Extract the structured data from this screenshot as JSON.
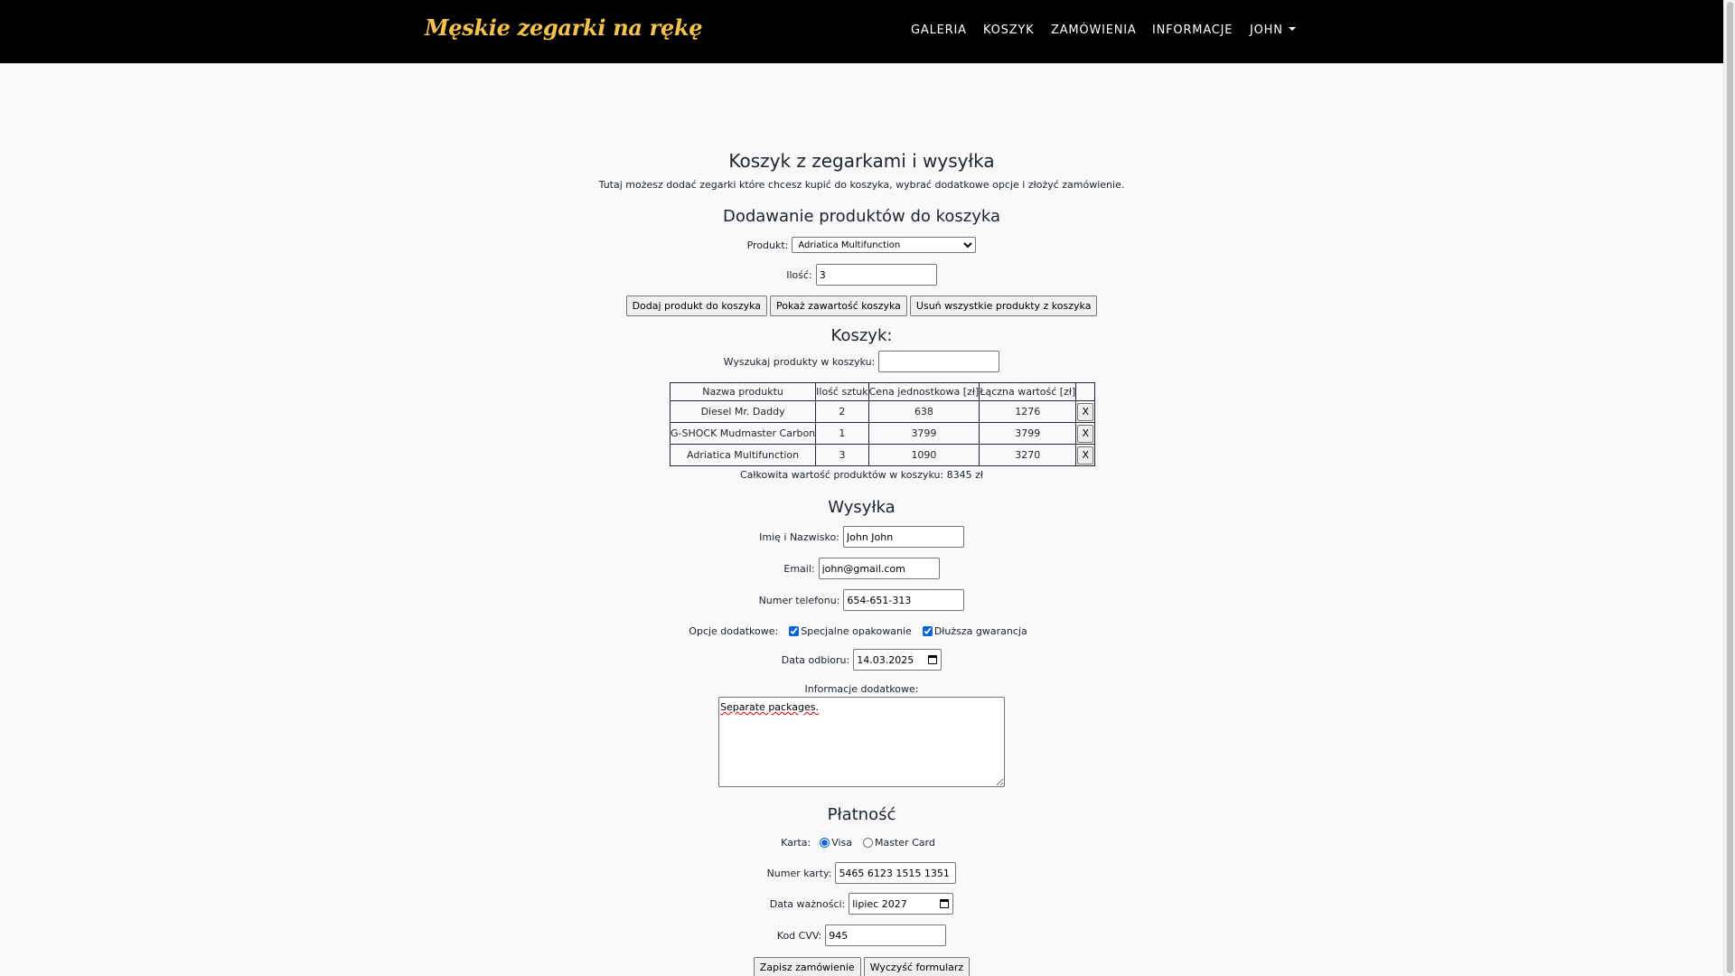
{
  "navbar": {
    "brand": "Męskie zegarki na rękę",
    "links": [
      "GALERIA",
      "KOSZYK",
      "ZAMÓWIENIA",
      "INFORMACJE"
    ],
    "user": "JOHN"
  },
  "header": {
    "title": "Koszyk z zegarkami i wysyłka",
    "description": "Tutaj możesz dodać zegarki które chcesz kupić do koszyka, wybrać dodatkowe opcje i złożyć zamówienie."
  },
  "add_section": {
    "heading": "Dodawanie produktów do koszyka",
    "product_label": "Produkt:",
    "product_selected": "Adriatica Multifunction",
    "qty_label": "Ilość:",
    "qty_value": "3",
    "btn_add": "Dodaj produkt do koszyka",
    "btn_show": "Pokaż zawartość koszyka",
    "btn_clear": "Usuń wszystkie produkty z koszyka"
  },
  "cart": {
    "heading": "Koszyk:",
    "search_label": "Wyszukaj produkty w koszyku:",
    "search_value": "",
    "columns": [
      "Nazwa produktu",
      "Ilość sztuk",
      "Cena jednostkowa [zł]",
      "Łączna wartość [zł]",
      ""
    ],
    "rows": [
      {
        "name": "Diesel Mr. Daddy",
        "qty": "2",
        "price": "638",
        "total": "1276",
        "remove": "X"
      },
      {
        "name": "G-SHOCK Mudmaster Carbon",
        "qty": "1",
        "price": "3799",
        "total": "3799",
        "remove": "X"
      },
      {
        "name": "Adriatica Multifunction",
        "qty": "3",
        "price": "1090",
        "total": "3270",
        "remove": "X"
      }
    ],
    "total_text": "Całkowita wartość produktów w koszyku: 8345 zł"
  },
  "shipping": {
    "heading": "Wysyłka",
    "name_label": "Imię i Nazwisko:",
    "name_value": "John John",
    "email_label": "Email:",
    "email_value": "john@gmail.com",
    "phone_label": "Numer telefonu:",
    "phone_value": "654-651-313",
    "options_label": "Opcje dodatkowe:",
    "option_1": "Specjalne opakowanie",
    "option_2": "Dłuższa gwarancja",
    "date_label": "Data odbioru:",
    "date_value": "14.03.2025",
    "info_label": "Informacje dodatkowe:",
    "info_value": "Separate packages."
  },
  "payment": {
    "heading": "Płatność",
    "card_label": "Karta:",
    "card_visa": "Visa",
    "card_master": "Master Card",
    "card_number_label": "Numer karty:",
    "card_number_value": "5465 6123 1515 1351",
    "expiry_label": "Data ważności:",
    "expiry_value": "lipiec 2027",
    "cvv_label": "Kod CVV:",
    "cvv_value": "945",
    "btn_save": "Zapisz zamówienie",
    "btn_reset": "Wyczyść formularz"
  },
  "colors": {
    "navbar_bg": "#000000",
    "brand": "#f5c24c",
    "page_bg": "#f8f9fa",
    "checkbox_accent": "#0b63d8"
  }
}
